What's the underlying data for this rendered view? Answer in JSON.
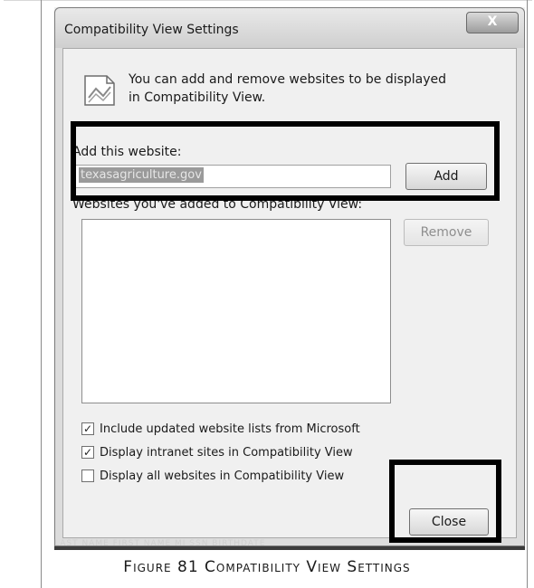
{
  "dialog": {
    "title": "Compatibility View Settings",
    "close_glyph": "X",
    "info_text": "You can add and remove websites to be displayed in Compatibility View.",
    "info_icon": "page-icon",
    "add_label": "Add this website:",
    "website_input_value": "texasagriculture.gov",
    "add_button": "Add",
    "list_label": "Websites you've added to Compatibility View:",
    "list_items": [],
    "remove_button": "Remove",
    "checkboxes": [
      {
        "label": "Include updated website lists from Microsoft",
        "checked": true
      },
      {
        "label": "Display intranet sites in Compatibility View",
        "checked": true
      },
      {
        "label": "Display all websites in Compatibility View",
        "checked": false
      }
    ],
    "close_button": "Close"
  },
  "background_text": "LAST NAME   FIRST NAME   MI   SSN   BIRTHDATE",
  "caption": "Figure 81 Compatibility View Settings"
}
